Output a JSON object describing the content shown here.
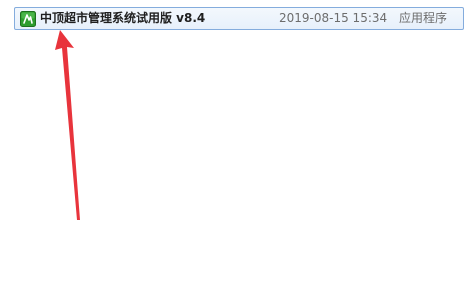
{
  "file_list": {
    "rows": [
      {
        "name": "中顶超市管理系统试用版 v8.4",
        "modified": "2019-08-15 15:34",
        "type": "应用程序",
        "icon": "app-icon",
        "selected": true
      }
    ]
  },
  "annotation": {
    "icon": "red-arrow",
    "color": "#e8343c"
  },
  "colors": {
    "selection_border": "#84acdd",
    "selection_fill": "#e7f0fb",
    "icon_green": "#2e9c2e"
  }
}
